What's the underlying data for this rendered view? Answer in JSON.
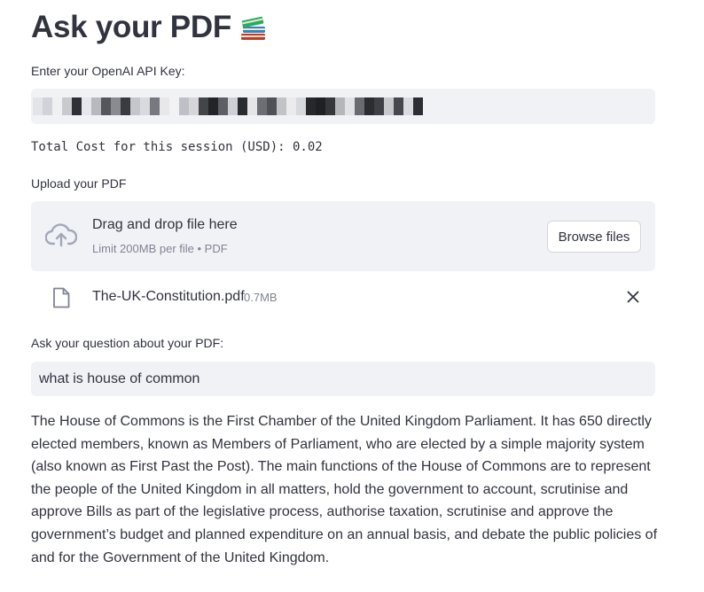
{
  "header": {
    "title": "Ask your PDF",
    "title_icon": "books-emoji-icon"
  },
  "api_key": {
    "label": "Enter your OpenAI API Key:",
    "value_state": "pixelated/obscured"
  },
  "cost": {
    "text": "Total Cost for this session (USD): 0.02"
  },
  "upload": {
    "label": "Upload your PDF",
    "drop_text": "Drag and drop file here",
    "limit_text": "Limit 200MB per file • PDF",
    "browse_label": "Browse files",
    "icon": "cloud-upload-icon"
  },
  "file": {
    "name": "The-UK-Constitution.pdf",
    "size": "0.7MB",
    "icon": "file-icon",
    "remove_icon": "close-icon"
  },
  "question": {
    "label": "Ask your question about your PDF:",
    "value": "what is house of common"
  },
  "answer": {
    "text": "The House of Commons is the First Chamber of the United Kingdom Parliament. It has 650 directly elected members, known as Members of Parliament, who are elected by a simple majority system (also known as First Past the Post). The main functions of the House of Commons are to represent the people of the United Kingdom in all matters, hold the government to account, scrutinise and approve Bills as part of the legislative process, authorise taxation, scrutinise and approve the government’s budget and planned expenditure on an annual basis, and debate the public policies of and for the Government of the United Kingdom."
  },
  "colors": {
    "text": "#31333f",
    "muted": "#808495",
    "field_bg": "#f0f2f6",
    "border": "#d6d6d9"
  }
}
